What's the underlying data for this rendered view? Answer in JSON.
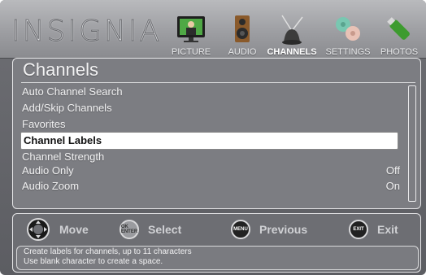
{
  "brand": "INSIGNIA",
  "tabs": [
    {
      "label": "PICTURE",
      "icon": "picture-tv-icon"
    },
    {
      "label": "AUDIO",
      "icon": "speaker-icon"
    },
    {
      "label": "CHANNELS",
      "icon": "antenna-icon",
      "active": true
    },
    {
      "label": "SETTINGS",
      "icon": "gears-icon"
    },
    {
      "label": "PHOTOS",
      "icon": "usb-drive-icon"
    }
  ],
  "panel": {
    "title": "Channels",
    "items": [
      {
        "label": "Auto Channel Search",
        "value": ""
      },
      {
        "label": "Add/Skip Channels",
        "value": ""
      },
      {
        "label": "Favorites",
        "value": ""
      },
      {
        "label": "Channel Labels",
        "value": "",
        "selected": true
      },
      {
        "label": "Channel Strength",
        "value": ""
      },
      {
        "label": "Audio Only",
        "value": "Off"
      },
      {
        "label": "Audio Zoom",
        "value": "On"
      }
    ]
  },
  "hints": [
    {
      "button": "",
      "label": "Move",
      "icon": "dpad-icon"
    },
    {
      "button": "OK ENTER",
      "label": "Select",
      "icon": "ok-button-icon"
    },
    {
      "button": "MENU",
      "label": "Previous",
      "icon": "menu-button-icon"
    },
    {
      "button": "EXIT",
      "label": "Exit",
      "icon": "exit-button-icon"
    }
  ],
  "info": {
    "line1": "Create labels for channels, up to 11 characters",
    "line2": "Use blank character to create a space."
  },
  "colors": {
    "background": "#5c5d62",
    "header": "#9d9ea2",
    "selection": "#ffffff",
    "text": "#f1f1f2"
  }
}
